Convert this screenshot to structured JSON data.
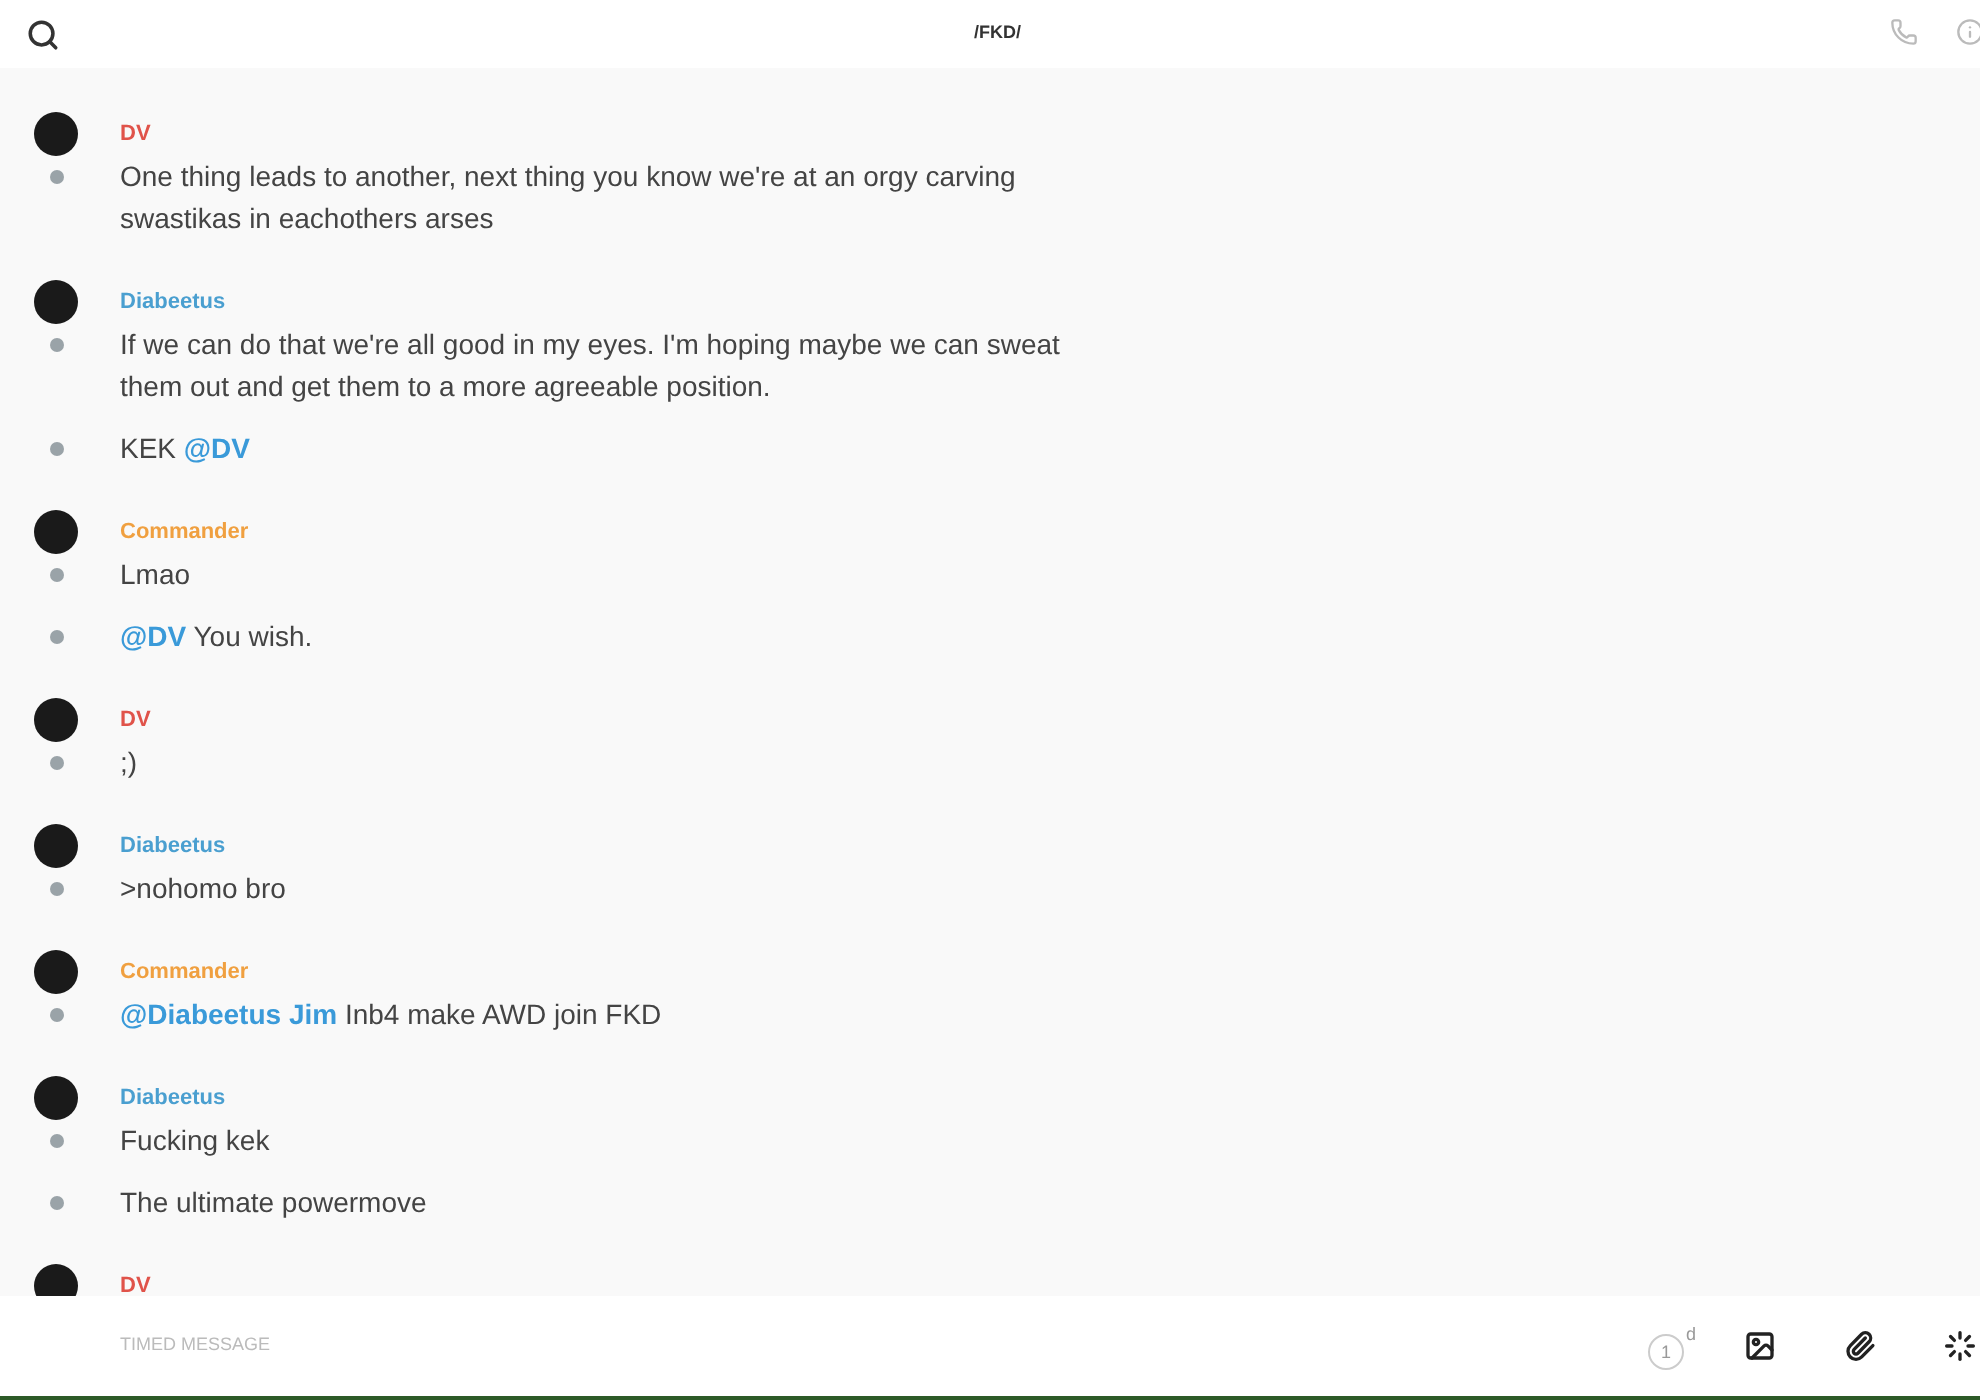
{
  "header": {
    "title": "/FKD/"
  },
  "groups": [
    {
      "author": "DV",
      "color": "#e0534a",
      "messages": [
        [
          {
            "kind": "text",
            "text": "One thing leads to another, next thing you know we're at an orgy carving swastikas in eachothers arses"
          }
        ]
      ]
    },
    {
      "author": "Diabeetus",
      "color": "#4a9fd0",
      "messages": [
        [
          {
            "kind": "text",
            "text": "If we can do that we're all good in my eyes. I'm hoping maybe we can sweat them out and get them to a more agreeable position."
          }
        ],
        [
          {
            "kind": "text",
            "text": "KEK "
          },
          {
            "kind": "mention",
            "text": "@DV"
          }
        ]
      ]
    },
    {
      "author": "Commander",
      "color": "#f0a040",
      "messages": [
        [
          {
            "kind": "text",
            "text": "Lmao"
          }
        ],
        [
          {
            "kind": "mention",
            "text": "@DV"
          },
          {
            "kind": "text",
            "text": " You wish."
          }
        ]
      ]
    },
    {
      "author": "DV",
      "color": "#e0534a",
      "messages": [
        [
          {
            "kind": "text",
            "text": ";)"
          }
        ]
      ]
    },
    {
      "author": "Diabeetus",
      "color": "#4a9fd0",
      "messages": [
        [
          {
            "kind": "text",
            "text": ">nohomo bro"
          }
        ]
      ]
    },
    {
      "author": "Commander",
      "color": "#f0a040",
      "messages": [
        [
          {
            "kind": "mention",
            "text": "@Diabeetus Jim"
          },
          {
            "kind": "text",
            "text": " Inb4 make AWD join FKD"
          }
        ]
      ]
    },
    {
      "author": "Diabeetus",
      "color": "#4a9fd0",
      "messages": [
        [
          {
            "kind": "text",
            "text": "Fucking kek"
          }
        ],
        [
          {
            "kind": "text",
            "text": "The ultimate powermove"
          }
        ]
      ]
    },
    {
      "author": "DV",
      "color": "#e0534a"
    }
  ],
  "composer": {
    "placeholder": "TIMED MESSAGE",
    "timer_value": "1",
    "timer_unit": "d"
  }
}
